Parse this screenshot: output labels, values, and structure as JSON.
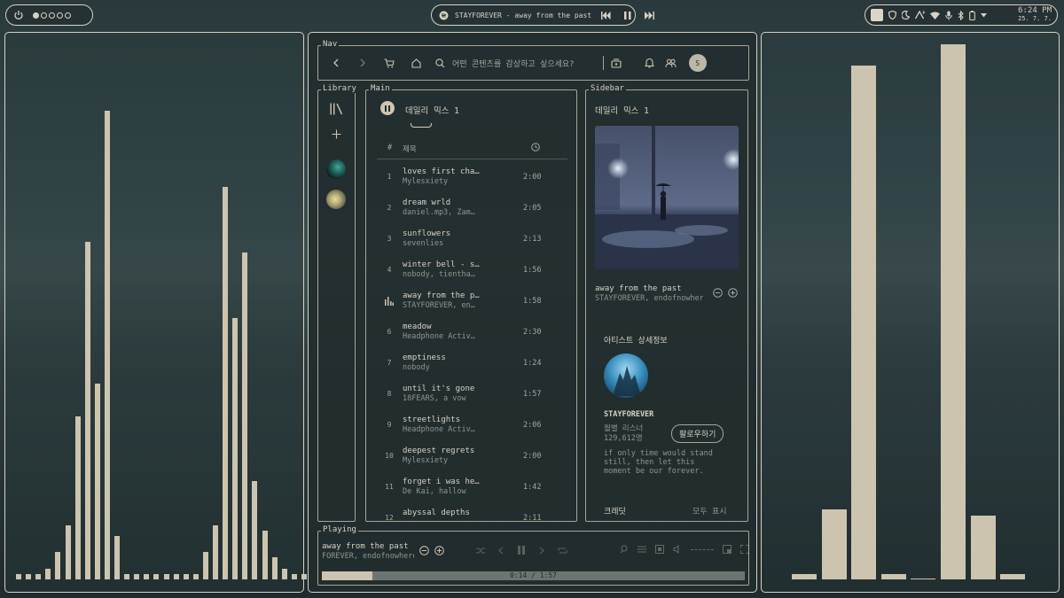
{
  "topbar": {
    "left": {
      "icon": "power-icon",
      "workspaces": [
        true,
        false,
        false,
        false,
        false
      ]
    },
    "center": {
      "track": "STAYFOREVER - away from the past",
      "icons": [
        "music-app-icon",
        "previous-icon",
        "pause-icon",
        "next-icon"
      ]
    },
    "right": {
      "icons": [
        "color-swatch-icon",
        "shield-icon",
        "moon-icon",
        "network-icon",
        "wifi-icon",
        "microphone-icon",
        "bluetooth-icon",
        "battery-icon",
        "chevron-down-icon"
      ],
      "time": "6:24 PM",
      "date": "25. 7. 7."
    }
  },
  "app": {
    "nav": {
      "label": "Nav",
      "search_placeholder": "어떤 콘텐츠를 감상하고 싶으세요?",
      "avatar": "S"
    },
    "library": {
      "label": "Library"
    },
    "main": {
      "label": "Main",
      "playlist_title": "데일리 믹스 1",
      "col_num": "#",
      "col_title": "제목",
      "tracks": [
        {
          "num": "1",
          "title": "loves first cha…",
          "artist": "Mylesxiety",
          "dur": "2:00"
        },
        {
          "num": "2",
          "title": "dream wrld",
          "artist": "daniel.mp3, Zam…",
          "dur": "2:05"
        },
        {
          "num": "3",
          "title": "sunflowers",
          "artist": "sevenlies",
          "dur": "2:13"
        },
        {
          "num": "4",
          "title": "winter bell - s…",
          "artist": "nobody, tientha…",
          "dur": "1:56"
        },
        {
          "num": "",
          "title": "away from the p…",
          "artist": "STAYFOREVER, en…",
          "dur": "1:58"
        },
        {
          "num": "6",
          "title": "meadow",
          "artist": "Headphone Activ…",
          "dur": "2:30"
        },
        {
          "num": "7",
          "title": "emptiness",
          "artist": "nobody",
          "dur": "1:24"
        },
        {
          "num": "8",
          "title": "until it's gone",
          "artist": "18FEARS, a vow",
          "dur": "1:57"
        },
        {
          "num": "9",
          "title": "streetlights",
          "artist": "Headphone Activ…",
          "dur": "2:06"
        },
        {
          "num": "10",
          "title": "deepest regrets",
          "artist": "Mylesxiety",
          "dur": "2:00"
        },
        {
          "num": "11",
          "title": "forget i was he…",
          "artist": "De Kai, hallow",
          "dur": "1:42"
        },
        {
          "num": "12",
          "title": "abyssal depths",
          "artist": "",
          "dur": "2:11"
        }
      ]
    },
    "sidebar": {
      "label": "Sidebar",
      "playlist_title": "데일리 믹스 1",
      "now_title": "away from the past",
      "now_artist": "STAYFOREVER, endofnowhere",
      "artist_section": "아티스트 상세정보",
      "artist_name": "STAYFOREVER",
      "listeners_label": "월별 리스너",
      "listeners": "129,612명",
      "follow": "팔로우하기",
      "bio": [
        "if only time would stand",
        "still, then let this",
        "moment be our forever."
      ],
      "credits": "크레딧",
      "show_all": "모두 표시"
    },
    "playing": {
      "label": "Playing",
      "title": "away from the past",
      "artist": "FOREVER, endofnowhere",
      "time": "0:14 / 1:57",
      "progress": 0.12
    }
  },
  "visualizer_left": [
    1,
    1,
    1,
    2,
    5,
    10,
    30,
    62,
    36,
    86,
    8,
    1,
    1,
    1,
    1,
    1,
    1,
    1,
    1,
    5,
    10,
    72,
    48,
    60,
    18,
    9,
    4,
    2,
    1,
    1
  ],
  "visualizer_right": [
    1,
    13,
    96,
    1,
    0,
    100,
    12,
    1
  ],
  "colors": {
    "bar": "#cdc4b0",
    "border": "#d8d2c4",
    "bg": "#232e30"
  }
}
